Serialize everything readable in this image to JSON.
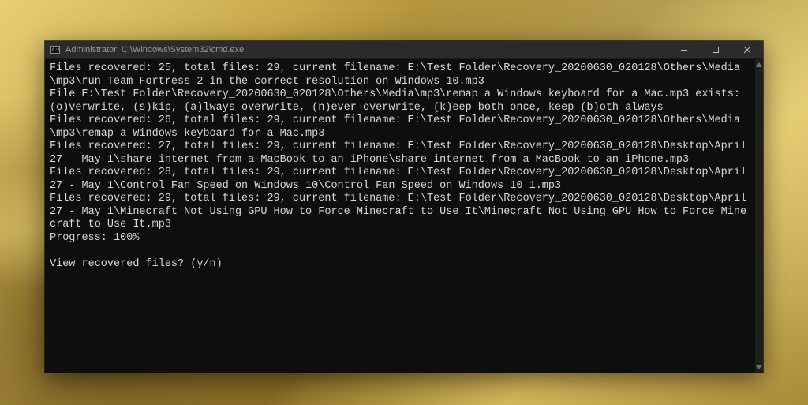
{
  "window": {
    "title": "Administrator: C:\\Windows\\System32\\cmd.exe"
  },
  "terminal": {
    "lines": [
      "Files recovered: 25, total files: 29, current filename: E:\\Test Folder\\Recovery_20200630_020128\\Others\\Media\\mp3\\run Team Fortress 2 in the correct resolution on Windows 10.mp3",
      "File E:\\Test Folder\\Recovery_20200630_020128\\Others\\Media\\mp3\\remap a Windows keyboard for a Mac.mp3 exists: (o)verwrite, (s)kip, (a)lways overwrite, (n)ever overwrite, (k)eep both once, keep (b)oth always",
      "Files recovered: 26, total files: 29, current filename: E:\\Test Folder\\Recovery_20200630_020128\\Others\\Media\\mp3\\remap a Windows keyboard for a Mac.mp3",
      "Files recovered: 27, total files: 29, current filename: E:\\Test Folder\\Recovery_20200630_020128\\Desktop\\April 27 - May 1\\share internet from a MacBook to an iPhone\\share internet from a MacBook to an iPhone.mp3",
      "Files recovered: 28, total files: 29, current filename: E:\\Test Folder\\Recovery_20200630_020128\\Desktop\\April 27 - May 1\\Control Fan Speed on Windows 10\\Control Fan Speed on Windows 10 1.mp3",
      "Files recovered: 29, total files: 29, current filename: E:\\Test Folder\\Recovery_20200630_020128\\Desktop\\April 27 - May 1\\Minecraft Not Using GPU How to Force Minecraft to Use It\\Minecraft Not Using GPU How to Force Minecraft to Use It.mp3",
      "Progress: 100%",
      "",
      "View recovered files? (y/n)"
    ]
  }
}
